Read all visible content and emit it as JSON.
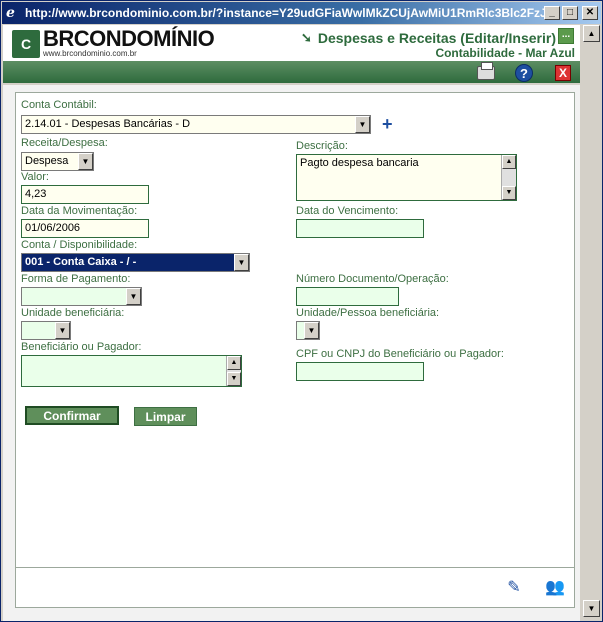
{
  "window": {
    "title": "http://www.brcondominio.com.br/?instance=Y29udGFiaWwlMkZCUjAwMiU1RmRlc3Blc2FzJ..."
  },
  "header": {
    "logo_mark": "C",
    "logo_name": "BRCONDOMÍNIO",
    "logo_url": "www.brcondominio.com.br",
    "title": "Despesas e Receitas (Editar/Inserir)",
    "subtitle": "Contabilidade - Mar Azul",
    "dots": "..."
  },
  "form": {
    "conta_contabil": {
      "label": "Conta Contábil:",
      "value": "2.14.01 - Despesas Bancárias - D"
    },
    "receita_despesa": {
      "label": "Receita/Despesa:",
      "value": "Despesa"
    },
    "descricao": {
      "label": "Descrição:",
      "value": "Pagto despesa bancaria"
    },
    "valor": {
      "label": "Valor:",
      "value": "4,23"
    },
    "data_movimentacao": {
      "label": "Data da Movimentação:",
      "value": "01/06/2006"
    },
    "data_vencimento": {
      "label": "Data do Vencimento:",
      "value": ""
    },
    "conta_disponibilidade": {
      "label": "Conta / Disponibilidade:",
      "value": "001 - Conta Caixa - / -"
    },
    "forma_pagamento": {
      "label": "Forma de Pagamento:",
      "value": ""
    },
    "numero_documento": {
      "label": "Número Documento/Operação:",
      "value": ""
    },
    "unidade_beneficiaria": {
      "label": "Unidade beneficiária:",
      "value": ""
    },
    "unidade_pessoa_beneficiaria": {
      "label": "Unidade/Pessoa beneficiária:",
      "value": ""
    },
    "beneficiario_pagador": {
      "label": "Beneficiário ou Pagador:",
      "value": ""
    },
    "cpf_cnpj": {
      "label": "CPF ou CNPJ do Beneficiário ou Pagador:",
      "value": ""
    }
  },
  "buttons": {
    "confirmar": "Confirmar",
    "limpar": "Limpar"
  },
  "icons": {
    "add": "+",
    "help": "?",
    "close": "X"
  }
}
